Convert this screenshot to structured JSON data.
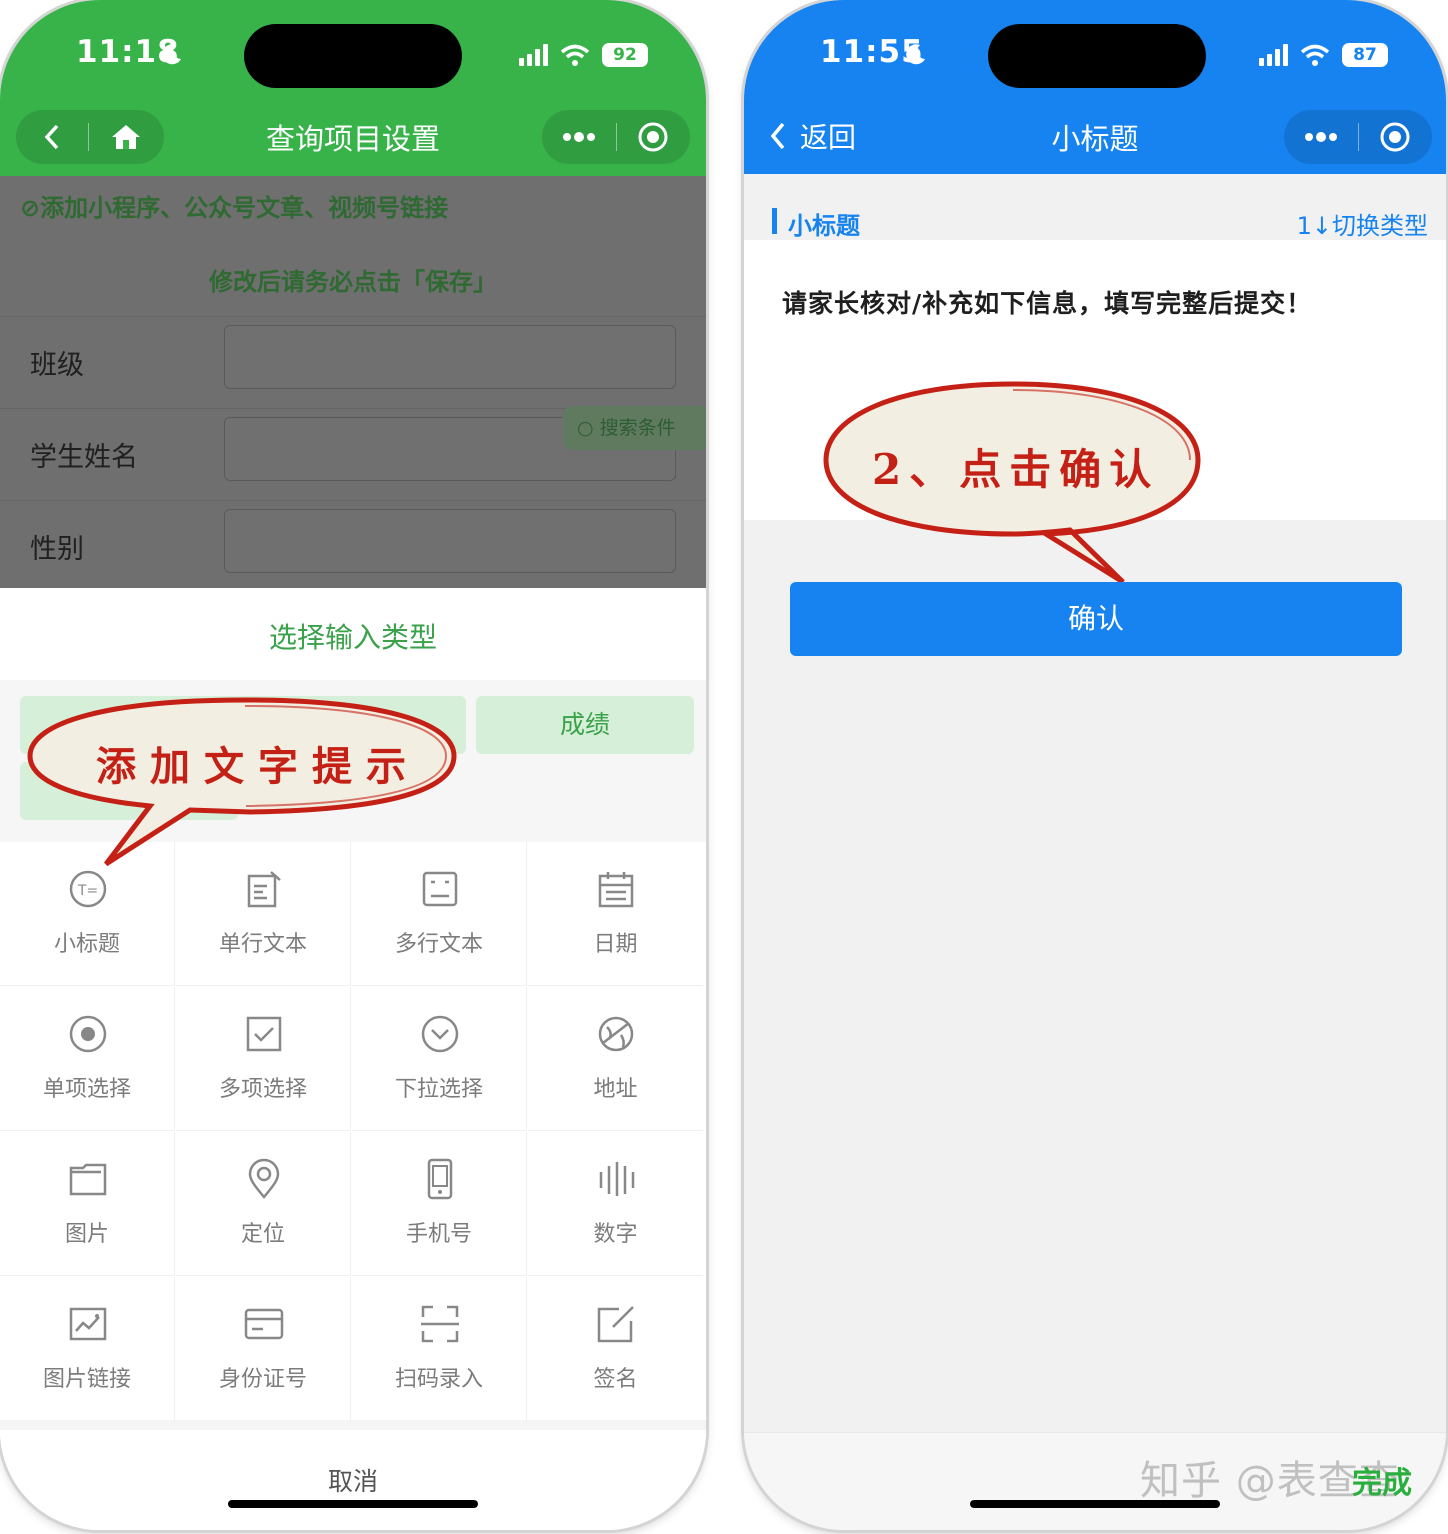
{
  "left": {
    "status": {
      "time": "11:18",
      "battery": "92"
    },
    "nav": {
      "title": "查询项目设置"
    },
    "banner": {
      "add_link": "⊘添加小程序、公众号文章、视频号链接",
      "save_notice": "修改后请务必点击「保存」"
    },
    "form": {
      "fields": [
        {
          "label": "班级"
        },
        {
          "label": "学生姓名"
        },
        {
          "label": "性别"
        }
      ],
      "search_chip": "搜索条件"
    },
    "sheet": {
      "title": "选择输入类型",
      "preset_chip": "成绩",
      "annotation": "添加文字提示",
      "items": [
        {
          "label": "小标题",
          "icon": "subtitle-icon"
        },
        {
          "label": "单行文本",
          "icon": "single-line-text-icon"
        },
        {
          "label": "多行文本",
          "icon": "multi-line-text-icon"
        },
        {
          "label": "日期",
          "icon": "calendar-icon"
        },
        {
          "label": "单项选择",
          "icon": "radio-icon"
        },
        {
          "label": "多项选择",
          "icon": "checkbox-icon"
        },
        {
          "label": "下拉选择",
          "icon": "dropdown-icon"
        },
        {
          "label": "地址",
          "icon": "globe-icon"
        },
        {
          "label": "图片",
          "icon": "folder-image-icon"
        },
        {
          "label": "定位",
          "icon": "location-pin-icon"
        },
        {
          "label": "手机号",
          "icon": "phone-icon"
        },
        {
          "label": "数字",
          "icon": "number-bars-icon"
        },
        {
          "label": "图片链接",
          "icon": "image-link-icon"
        },
        {
          "label": "身份证号",
          "icon": "id-card-icon"
        },
        {
          "label": "扫码录入",
          "icon": "scan-icon"
        },
        {
          "label": "签名",
          "icon": "signature-icon"
        }
      ],
      "cancel": "取消"
    }
  },
  "right": {
    "status": {
      "time": "11:55",
      "battery": "87"
    },
    "nav": {
      "back": "返回",
      "title": "小标题"
    },
    "section": {
      "title": "小标题",
      "switch": "1↓切换类型"
    },
    "content": {
      "text": "请家长核对/补充如下信息，填写完整后提交！"
    },
    "annotation": "2、点击确认",
    "confirm": "确认",
    "done": "完成",
    "watermark": "知乎 @表查查"
  },
  "colors": {
    "green": "#37b34a",
    "blue": "#1683f0",
    "annotation_red": "#c42016"
  }
}
